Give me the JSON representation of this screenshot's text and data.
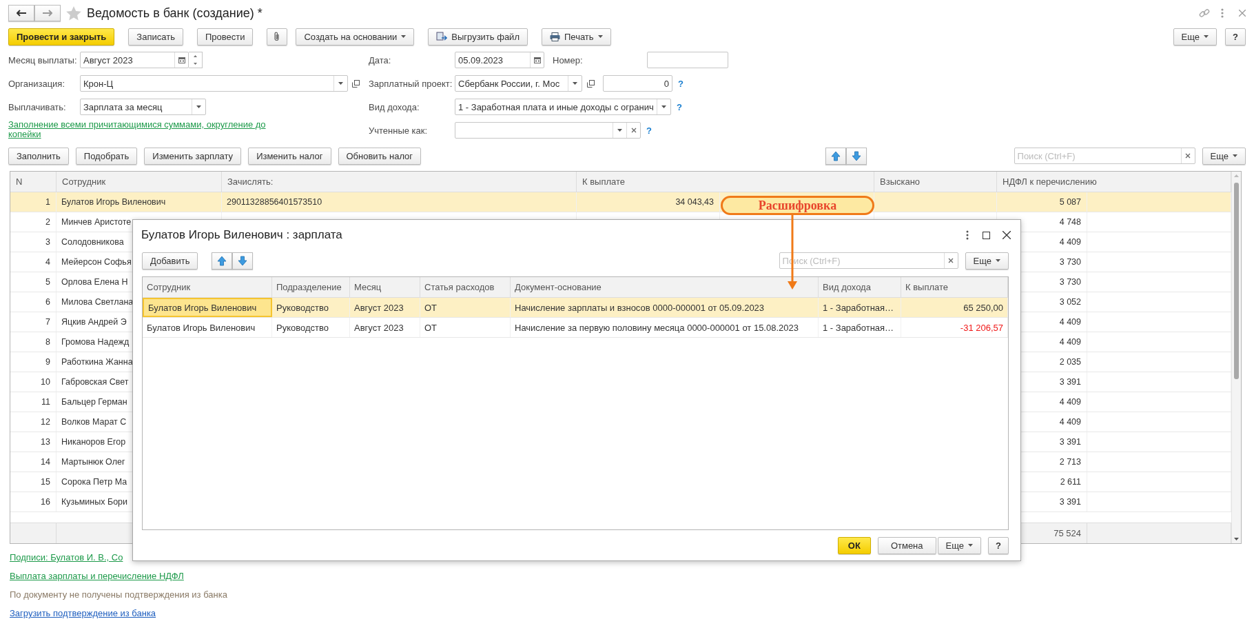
{
  "window": {
    "title": "Ведомость в банк (создание) *"
  },
  "toolbar": {
    "buttons": [
      {
        "kind": "primary",
        "label": "Провести и закрыть"
      },
      {
        "kind": "plain",
        "label": "Записать"
      },
      {
        "kind": "plain",
        "label": "Провести"
      },
      {
        "kind": "attach"
      },
      {
        "kind": "menu",
        "label": "Создать на основании"
      },
      {
        "kind": "upload",
        "label": "Выгрузить файл"
      },
      {
        "kind": "print",
        "label": "Печать"
      }
    ],
    "more": "Еще",
    "help": "?"
  },
  "fields": {
    "pay_month": {
      "label": "Месяц выплаты:",
      "value": "Август 2023"
    },
    "organization": {
      "label": "Организация:",
      "value": "Крон-Ц"
    },
    "pay_type": {
      "label": "Выплачивать:",
      "value": "Зарплата за месяц"
    },
    "fill_link": "Заполнение всеми причитающимися суммами, округление до копейки",
    "date": {
      "label": "Дата:",
      "value": "05.09.2023"
    },
    "number": {
      "label": "Номер:"
    },
    "salary_project": {
      "label": "Зарплатный проект:",
      "value": "Сбербанк России, г. Мос",
      "amount": "0",
      "help": "?"
    },
    "income_type": {
      "label": "Вид дохода:",
      "value": "1 - Заработная плата и иные доходы с огранич",
      "help": "?"
    },
    "counted_as": {
      "label": "Учтенные как:",
      "help": "?"
    }
  },
  "table_toolbar": {
    "buttons": [
      "Заполнить",
      "Подобрать",
      "Изменить зарплату",
      "Изменить налог",
      "Обновить налог"
    ],
    "search": {
      "placeholder": "Поиск (Ctrl+F)"
    },
    "more": "Еще"
  },
  "table": {
    "columns": [
      "N",
      "Сотрудник",
      "Зачислять:",
      "К выплате",
      "Взыскано",
      "НДФЛ к перечислению"
    ],
    "rows": [
      {
        "n": "1",
        "employee": "Булатов Игорь Виленович",
        "account": "29011328856401573510",
        "pay": "34 043,43",
        "tax": "5 087",
        "selected": true
      },
      {
        "n": "2",
        "employee": "Минчев Аристоте",
        "tax": "4 748",
        "selected": false
      },
      {
        "n": "3",
        "employee": "Солодовникова",
        "tax": "4 409",
        "selected": false
      },
      {
        "n": "4",
        "employee": "Мейерсон Софья",
        "tax": "3 730",
        "selected": false
      },
      {
        "n": "5",
        "employee": "Орлова Елена Н",
        "tax": "3 730",
        "selected": false
      },
      {
        "n": "6",
        "employee": "Милова Светлана",
        "tax": "3 052",
        "selected": false
      },
      {
        "n": "7",
        "employee": "Яцкив Андрей Э",
        "tax": "4 409",
        "selected": false
      },
      {
        "n": "8",
        "employee": "Громова Надежд",
        "tax": "4 409",
        "selected": false
      },
      {
        "n": "9",
        "employee": "Работкина Жанна",
        "tax": "2 035",
        "selected": false
      },
      {
        "n": "10",
        "employee": "Габровская Свет",
        "tax": "3 391",
        "selected": false
      },
      {
        "n": "11",
        "employee": "Бальцер Герман",
        "tax": "4 409",
        "selected": false
      },
      {
        "n": "12",
        "employee": "Волков Марат С",
        "tax": "4 409",
        "selected": false
      },
      {
        "n": "13",
        "employee": "Никаноров Егор",
        "tax": "3 391",
        "selected": false
      },
      {
        "n": "14",
        "employee": "Мартынюк Олег",
        "tax": "2 713",
        "selected": false
      },
      {
        "n": "15",
        "employee": "Сорока Петр Ма",
        "tax": "2 611",
        "selected": false
      },
      {
        "n": "16",
        "employee": "Кузьминых Бори",
        "tax": "3 391",
        "selected": false
      }
    ],
    "totals": {
      "tax": "75 524"
    }
  },
  "footer": [
    {
      "kind": "green_link",
      "text": "Подписи: Булатов И. В., Со"
    },
    {
      "kind": "green_link",
      "text": "Выплата зарплаты и перечисление НДФЛ"
    },
    {
      "kind": "note",
      "text": "По документу не получены подтверждения из банка"
    },
    {
      "kind": "blue_link",
      "text": "Загрузить подтверждение из банка"
    }
  ],
  "dialog": {
    "title": "Булатов Игорь Виленович : зарплата",
    "add": "Добавить",
    "search": {
      "placeholder": "Поиск (Ctrl+F)"
    },
    "more": "Еще",
    "columns": [
      "Сотрудник",
      "Подразделение",
      "Месяц",
      "Статья расходов",
      "Документ-основание",
      "Вид дохода",
      "К выплате"
    ],
    "rows": [
      {
        "cells": [
          "Булатов Игорь Виленович",
          "Руководство",
          "Август 2023",
          "ОТ",
          "Начисление зарплаты и взносов 0000-000001 от 05.09.2023",
          "1 - Заработная…",
          "65 250,00"
        ],
        "selected": true,
        "negative": false
      },
      {
        "cells": [
          "Булатов Игорь Виленович",
          "Руководство",
          "Август 2023",
          "ОТ",
          "Начисление за первую половину месяца 0000-000001 от 15.08.2023",
          "1 - Заработная…",
          "-31 206,57"
        ],
        "selected": false,
        "negative": true
      }
    ],
    "ok": "ОК",
    "cancel": "Отмена",
    "bottom_more": "Еще",
    "help": "?"
  },
  "callout": {
    "text": "Расшифровка"
  }
}
